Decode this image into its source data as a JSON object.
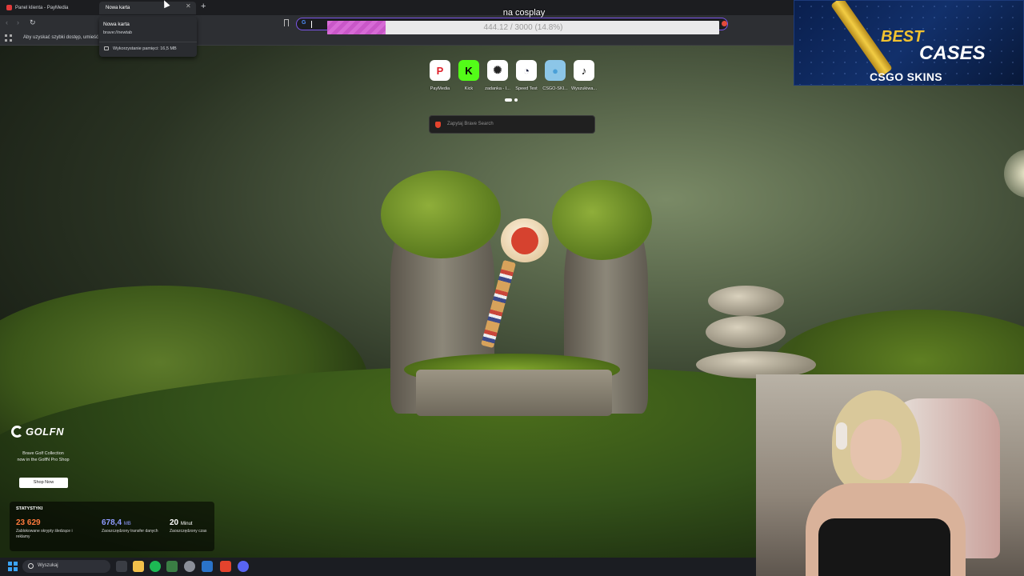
{
  "tabs": [
    {
      "title": "Panel klienta - PayMedia"
    },
    {
      "title": "Nowa karta"
    }
  ],
  "tab_hover": {
    "title": "Nowa karta",
    "url": "brave://newtab",
    "memory": "Wykorzystanie pamięci: 16,5 MB"
  },
  "bookmarks_bar": {
    "hint": "Aby uzyskać szybki dostęp, umieść"
  },
  "goal": {
    "title": "na cosplay",
    "text": "444.12 / 3000 (14.8%)",
    "current": 444.12,
    "target": 3000,
    "percent": 14.8,
    "fill_color": "#d76bd6"
  },
  "ad": {
    "word1": "BEST",
    "word2": "CASES",
    "brand": "CSGO SKINS"
  },
  "speed_dials": [
    {
      "label": "PayMedia",
      "icon": "paymedia-icon",
      "glyph": "P",
      "bg": "#ffffff",
      "fg": "#e0202a"
    },
    {
      "label": "Kick",
      "icon": "kick-icon",
      "glyph": "K",
      "bg": "#53fc18",
      "fg": "#000000"
    },
    {
      "label": "zadanka - I...",
      "icon": "chatgpt-icon",
      "glyph": "✺",
      "bg": "#ffffff",
      "fg": "#222222"
    },
    {
      "label": "Speed Test",
      "icon": "speedtest-icon",
      "glyph": "◔",
      "bg": "#ffffff",
      "fg": "#1a1f3c"
    },
    {
      "label": "CSGO-SKI...",
      "icon": "csgoskins-icon",
      "glyph": "●",
      "bg": "#8cc6e8",
      "fg": "#4aa0d8"
    },
    {
      "label": "Wyszukiwa...",
      "icon": "tiktok-icon",
      "glyph": "♪",
      "bg": "#ffffff",
      "fg": "#000000"
    }
  ],
  "search": {
    "placeholder": "Zapytaj Brave Search"
  },
  "promo": {
    "brand": "GOLFN",
    "line1": "Brave Golf Collection",
    "line2": "now in the GolfN Pro Shop",
    "button": "Shop Now"
  },
  "stats": {
    "title": "STATYSTYKI",
    "items": [
      {
        "value": "23 629",
        "unit": "",
        "desc": "Zablokowane skrypty śledzące i reklamy",
        "color": "#ff7a3d"
      },
      {
        "value": "678,4",
        "unit": "MB",
        "desc": "Zaoszczędzony transfer danych",
        "color": "#8f9bff"
      },
      {
        "value": "20",
        "unit": "Minut",
        "desc": "Zaoszczędzony czas",
        "color": "#ffffff"
      }
    ]
  },
  "taskbar": {
    "search": "Wyszukaj"
  }
}
